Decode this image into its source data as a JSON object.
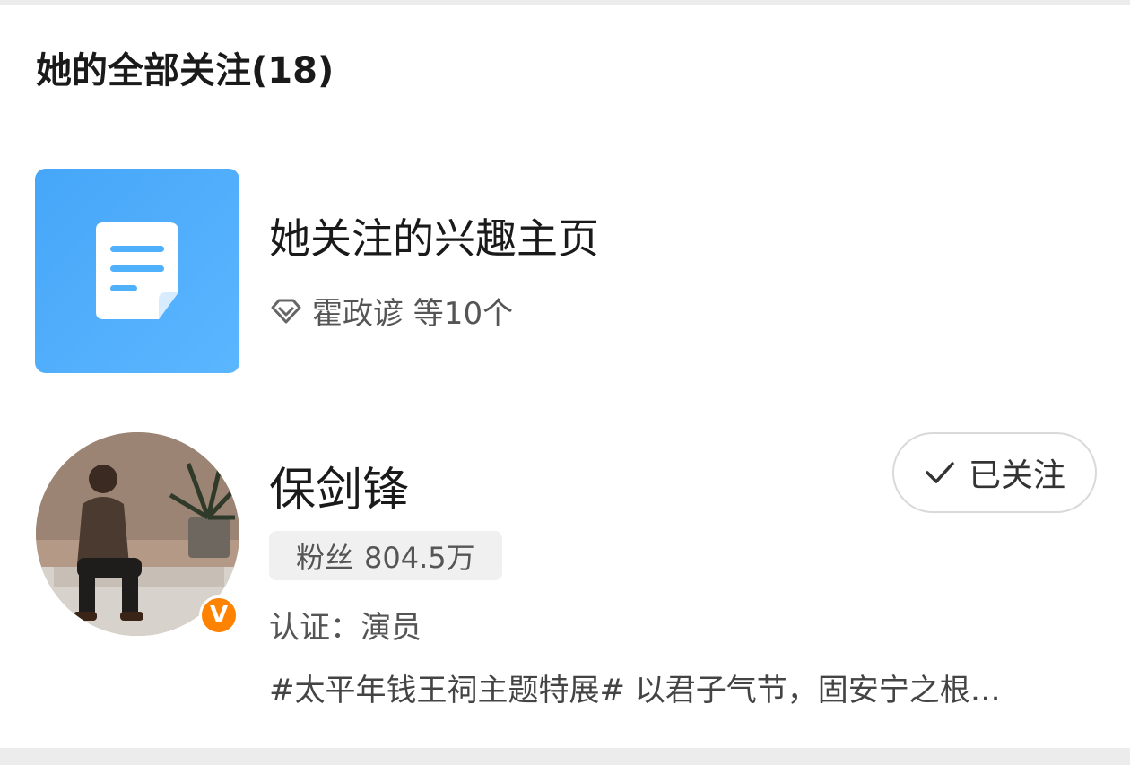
{
  "page": {
    "title": "她的全部关注(18)"
  },
  "interest": {
    "title": "她关注的兴趣主页",
    "subtitle": "霍政谚 等10个",
    "tile_icon": "document-icon",
    "sub_icon": "diamond-icon",
    "tile_color": "#4fb0fc"
  },
  "user": {
    "name": "保剑锋",
    "follow_label": "已关注",
    "follow_icon": "check-icon",
    "fans_label": "粉丝",
    "fans_count": "804.5万",
    "cert": "认证：演员",
    "bio": "#太平年钱王祠主题特展# 以君子气节，固安宁之根…",
    "badge_letter": "V",
    "badge_color": "#ff8200"
  }
}
